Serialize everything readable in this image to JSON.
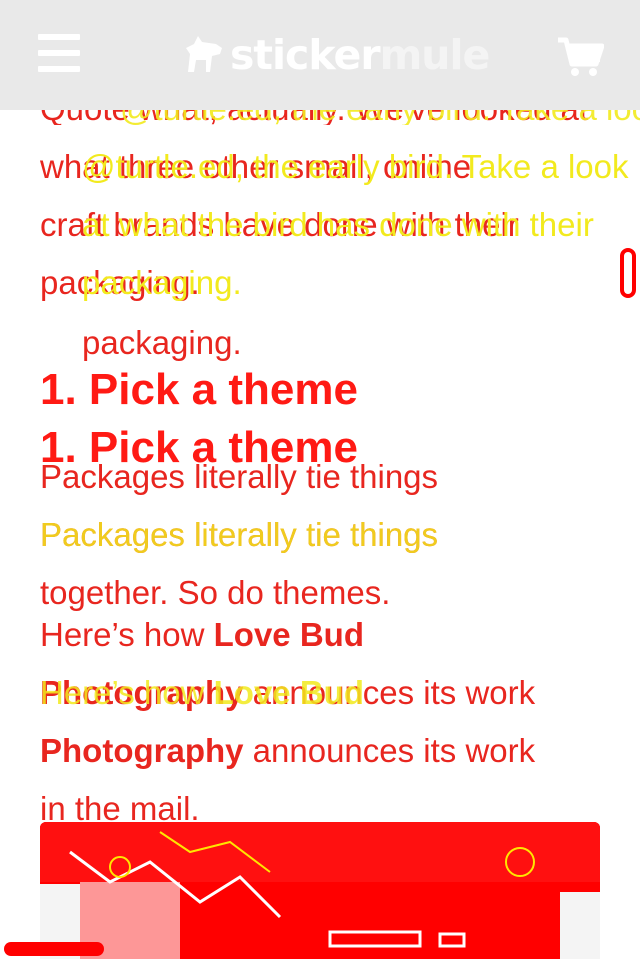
{
  "header": {
    "menu_icon": "hamburger-icon",
    "logo_word_1": "sticker",
    "logo_word_2": "mule",
    "cart_icon": "cart-icon"
  },
  "article": {
    "intro_lines": [
      "Quote what, actually. We've looked at",
      "what three other small, online",
      "craft brands have done with their",
      "packaging."
    ],
    "ghost_lines": [
      "@turtle.ed, the early bird. Take a look",
      "at what the bird has done with their",
      "packaging."
    ],
    "heading_1": "1. Pick a theme",
    "heading_1_ghost": "1. Pick a theme",
    "para_1_lines": [
      "Packages literally tie things",
      "together. So do themes."
    ],
    "para_1_ghost": "Packages literally tie things",
    "para_2_prefix": "Here’s how ",
    "para_2_bold_a": "Love Bud",
    "para_2_bold_b": "Photography",
    "para_2_mid": " announces its work",
    "para_2_tail": "in the mail."
  },
  "colors": {
    "red": "#e8261f",
    "yellow": "#f2ea1e",
    "topbar": "#e9e9e9"
  }
}
